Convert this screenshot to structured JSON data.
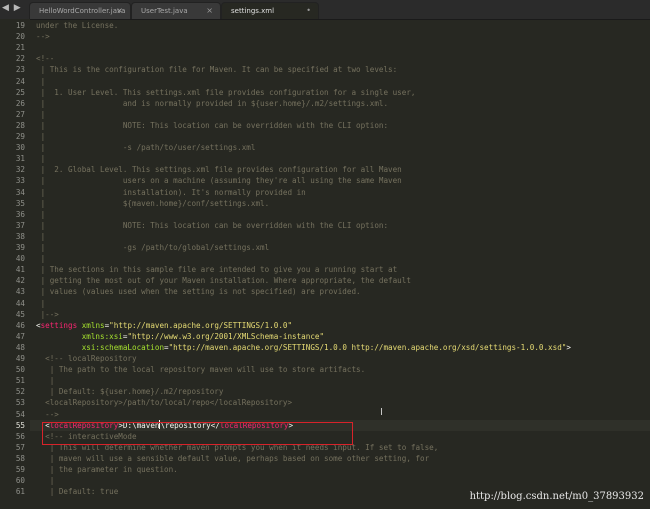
{
  "tabs": [
    {
      "label": "HelloWordController.java",
      "close": "×",
      "active": false
    },
    {
      "label": "UserTest.java",
      "close": "×",
      "active": false
    },
    {
      "label": "settings.xml",
      "close": "•",
      "active": true
    }
  ],
  "nav_arrows": "◀ ▶",
  "current_line": 55,
  "lines": [
    {
      "n": 19,
      "segs": [
        {
          "c": "c",
          "t": "under the License."
        }
      ]
    },
    {
      "n": 20,
      "segs": [
        {
          "c": "c",
          "t": "-->"
        }
      ]
    },
    {
      "n": 21,
      "segs": []
    },
    {
      "n": 22,
      "segs": [
        {
          "c": "c",
          "t": "<!--"
        }
      ]
    },
    {
      "n": 23,
      "segs": [
        {
          "c": "c",
          "t": " | This is the configuration file for Maven. It can be specified at two levels:"
        }
      ]
    },
    {
      "n": 24,
      "segs": [
        {
          "c": "c",
          "t": " |"
        }
      ]
    },
    {
      "n": 25,
      "segs": [
        {
          "c": "c",
          "t": " |  1. User Level. This settings.xml file provides configuration for a single user,"
        }
      ]
    },
    {
      "n": 26,
      "segs": [
        {
          "c": "c",
          "t": " |                 and is normally provided in ${user.home}/.m2/settings.xml."
        }
      ]
    },
    {
      "n": 27,
      "segs": [
        {
          "c": "c",
          "t": " |"
        }
      ]
    },
    {
      "n": 28,
      "segs": [
        {
          "c": "c",
          "t": " |                 NOTE: This location can be overridden with the CLI option:"
        }
      ]
    },
    {
      "n": 29,
      "segs": [
        {
          "c": "c",
          "t": " |"
        }
      ]
    },
    {
      "n": 30,
      "segs": [
        {
          "c": "c",
          "t": " |                 -s /path/to/user/settings.xml"
        }
      ]
    },
    {
      "n": 31,
      "segs": [
        {
          "c": "c",
          "t": " |"
        }
      ]
    },
    {
      "n": 32,
      "segs": [
        {
          "c": "c",
          "t": " |  2. Global Level. This settings.xml file provides configuration for all Maven"
        }
      ]
    },
    {
      "n": 33,
      "segs": [
        {
          "c": "c",
          "t": " |                 users on a machine (assuming they're all using the same Maven"
        }
      ]
    },
    {
      "n": 34,
      "segs": [
        {
          "c": "c",
          "t": " |                 installation). It's normally provided in"
        }
      ]
    },
    {
      "n": 35,
      "segs": [
        {
          "c": "c",
          "t": " |                 ${maven.home}/conf/settings.xml."
        }
      ]
    },
    {
      "n": 36,
      "segs": [
        {
          "c": "c",
          "t": " |"
        }
      ]
    },
    {
      "n": 37,
      "segs": [
        {
          "c": "c",
          "t": " |                 NOTE: This location can be overridden with the CLI option:"
        }
      ]
    },
    {
      "n": 38,
      "segs": [
        {
          "c": "c",
          "t": " |"
        }
      ]
    },
    {
      "n": 39,
      "segs": [
        {
          "c": "c",
          "t": " |                 -gs /path/to/global/settings.xml"
        }
      ]
    },
    {
      "n": 40,
      "segs": [
        {
          "c": "c",
          "t": " |"
        }
      ]
    },
    {
      "n": 41,
      "segs": [
        {
          "c": "c",
          "t": " | The sections in this sample file are intended to give you a running start at"
        }
      ]
    },
    {
      "n": 42,
      "segs": [
        {
          "c": "c",
          "t": " | getting the most out of your Maven installation. Where appropriate, the default"
        }
      ]
    },
    {
      "n": 43,
      "segs": [
        {
          "c": "c",
          "t": " | values (values used when the setting is not specified) are provided."
        }
      ]
    },
    {
      "n": 44,
      "segs": [
        {
          "c": "c",
          "t": " |"
        }
      ]
    },
    {
      "n": 45,
      "segs": [
        {
          "c": "c",
          "t": " |-->"
        }
      ]
    },
    {
      "n": 46,
      "segs": [
        {
          "c": "punct",
          "t": "<"
        },
        {
          "c": "tag",
          "t": "settings"
        },
        {
          "c": "txt",
          "t": " "
        },
        {
          "c": "attr",
          "t": "xmlns"
        },
        {
          "c": "punct",
          "t": "="
        },
        {
          "c": "str",
          "t": "\"http://maven.apache.org/SETTINGS/1.0.0\""
        }
      ]
    },
    {
      "n": 47,
      "segs": [
        {
          "c": "txt",
          "t": "          "
        },
        {
          "c": "attr",
          "t": "xmlns:xsi"
        },
        {
          "c": "punct",
          "t": "="
        },
        {
          "c": "str",
          "t": "\"http://www.w3.org/2001/XMLSchema-instance\""
        }
      ]
    },
    {
      "n": 48,
      "segs": [
        {
          "c": "txt",
          "t": "          "
        },
        {
          "c": "attr",
          "t": "xsi:schemaLocation"
        },
        {
          "c": "punct",
          "t": "="
        },
        {
          "c": "str",
          "t": "\"http://maven.apache.org/SETTINGS/1.0.0 http://maven.apache.org/xsd/settings-1.0.0.xsd\""
        },
        {
          "c": "punct",
          "t": ">"
        }
      ]
    },
    {
      "n": 49,
      "segs": [
        {
          "c": "c",
          "t": "  <!-- localRepository"
        }
      ]
    },
    {
      "n": 50,
      "segs": [
        {
          "c": "c",
          "t": "   | The path to the local repository maven will use to store artifacts."
        }
      ]
    },
    {
      "n": 51,
      "segs": [
        {
          "c": "c",
          "t": "   |"
        }
      ]
    },
    {
      "n": 52,
      "segs": [
        {
          "c": "c",
          "t": "   | Default: ${user.home}/.m2/repository"
        }
      ]
    },
    {
      "n": 53,
      "segs": [
        {
          "c": "c",
          "t": "  <localRepository>/path/to/local/repo</localRepository>"
        }
      ]
    },
    {
      "n": 54,
      "segs": [
        {
          "c": "c",
          "t": "  -->"
        }
      ]
    },
    {
      "n": 55,
      "segs": [
        {
          "c": "txt",
          "t": "  "
        },
        {
          "c": "punct",
          "t": "<"
        },
        {
          "c": "tag",
          "t": "localRepository"
        },
        {
          "c": "punct",
          "t": ">"
        },
        {
          "c": "txt",
          "t": "D:\\maven"
        },
        {
          "c": "caret",
          "t": ""
        },
        {
          "c": "txt",
          "t": "\\repository"
        },
        {
          "c": "punct",
          "t": "</"
        },
        {
          "c": "tag",
          "t": "localRepository"
        },
        {
          "c": "punct",
          "t": ">"
        }
      ]
    },
    {
      "n": 56,
      "segs": [
        {
          "c": "c",
          "t": "  <!-- interactiveMode"
        }
      ]
    },
    {
      "n": 57,
      "segs": [
        {
          "c": "c",
          "t": "   | This will determine whether maven prompts you when it needs input. If set to false,"
        }
      ]
    },
    {
      "n": 58,
      "segs": [
        {
          "c": "c",
          "t": "   | maven will use a sensible default value, perhaps based on some other setting, for"
        }
      ]
    },
    {
      "n": 59,
      "segs": [
        {
          "c": "c",
          "t": "   | the parameter in question."
        }
      ]
    },
    {
      "n": 60,
      "segs": [
        {
          "c": "c",
          "t": "   |"
        }
      ]
    },
    {
      "n": 61,
      "segs": [
        {
          "c": "c",
          "t": "   | Default: true"
        }
      ]
    }
  ],
  "watermark": "http://blog.csdn.net/m0_37893932",
  "colors": {
    "background": "#272822",
    "comment": "#75715e",
    "tag": "#f92672",
    "attribute": "#a6e22e",
    "string": "#e6db74",
    "highlight_box": "#d8232a"
  }
}
